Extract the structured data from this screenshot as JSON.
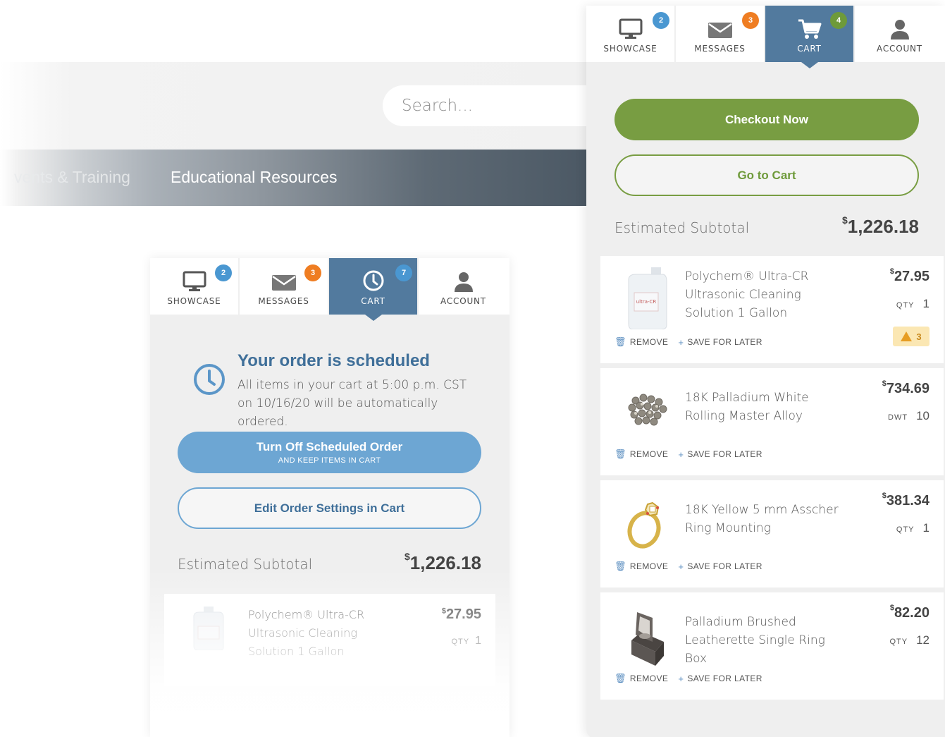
{
  "background": {
    "search_placeholder": "Search...",
    "nav": [
      "vents & Training",
      "Educational Resources"
    ]
  },
  "tabs": {
    "showcase": "SHOWCASE",
    "messages": "MESSAGES",
    "cart": "CART",
    "account": "ACCOUNT"
  },
  "mid_widget": {
    "badges": {
      "showcase": "2",
      "messages": "3",
      "cart": "7"
    },
    "sched_title": "Your order is scheduled",
    "sched_text": "All items in your cart at 5:00 p.m. CST on 10/16/20  will be automatically ordered.",
    "turnoff_main": "Turn Off Scheduled Order",
    "turnoff_sub": "AND KEEP ITEMS IN CART",
    "edit_label": "Edit Order Settings in Cart",
    "subtotal_label": "Estimated Subtotal",
    "subtotal_currency": "$",
    "subtotal_value": "1,226.18",
    "item": {
      "name": "Polychem® Ultra-CR Ultrasonic Cleaning Solution 1 Gallon",
      "currency": "$",
      "price": "27.95",
      "qty_label": "QTY",
      "qty": "1"
    }
  },
  "cart_widget": {
    "badges": {
      "showcase": "2",
      "messages": "3",
      "cart": "4"
    },
    "checkout_label": "Checkout Now",
    "gotocart_label": "Go to Cart",
    "subtotal_label": "Estimated Subtotal",
    "subtotal_currency": "$",
    "subtotal_value": "1,226.18",
    "remove_label": "REMOVE",
    "save_label": "SAVE FOR LATER",
    "items": [
      {
        "name": "Polychem® Ultra-CR Ultrasonic Cleaning Solution 1 Gallon",
        "currency": "$",
        "price": "27.95",
        "qty_label": "QTY",
        "qty": "1",
        "warning": "3",
        "thumb": "gallon-jug-icon"
      },
      {
        "name": "18K Palladium White Rolling Master Alloy",
        "currency": "$",
        "price": "734.69",
        "qty_label": "DWT",
        "qty": "10",
        "thumb": "alloy-pellets-icon"
      },
      {
        "name": "18K Yellow 5 mm Asscher Ring Mounting",
        "currency": "$",
        "price": "381.34",
        "qty_label": "QTY",
        "qty": "1",
        "thumb": "ring-icon"
      },
      {
        "name": "Palladium Brushed Leatherette Single Ring Box",
        "currency": "$",
        "price": "82.20",
        "qty_label": "QTY",
        "qty": "12",
        "thumb": "ring-box-icon"
      }
    ]
  },
  "colors": {
    "accent_blue": "#527a9e",
    "badge_blue": "#4a97d1",
    "badge_orange": "#ef7d22",
    "badge_green": "#6e9a3a",
    "checkout_green": "#789d42",
    "scheduled_blue": "#6da6d3",
    "warning_bg": "#fbe7b3"
  }
}
